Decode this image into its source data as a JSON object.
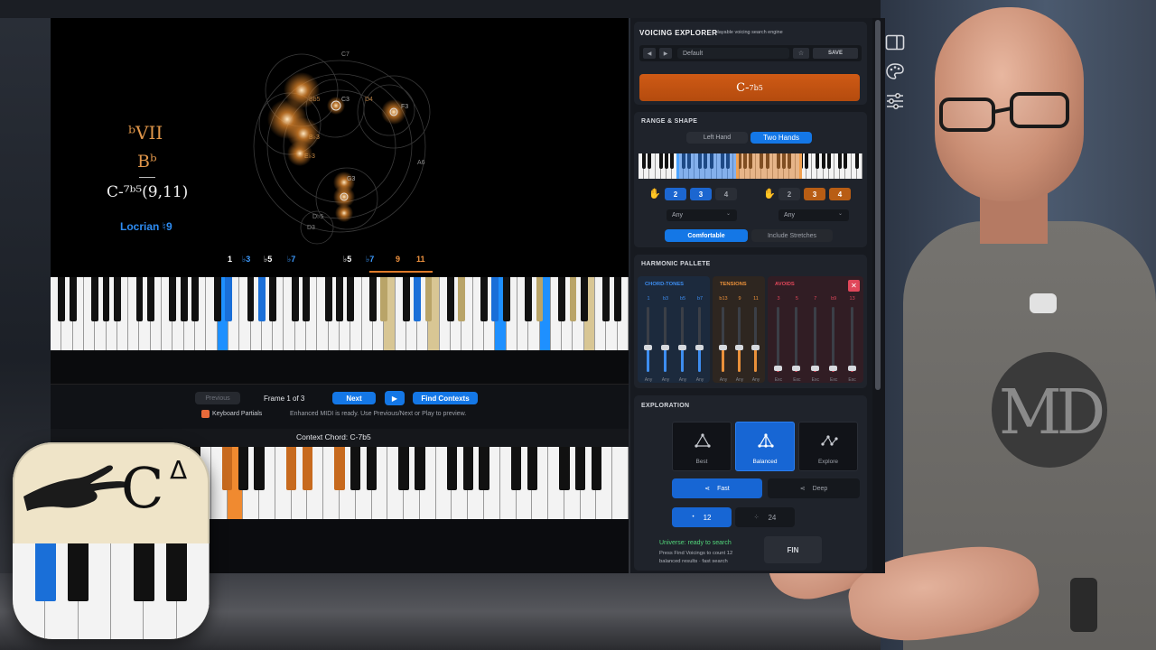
{
  "analysis": {
    "roman_numeral": "ᵇVII",
    "root_chord": "Bᵇ",
    "slash_chord": "C-⁷ᵇ⁵(9,11)",
    "scale_name": "Locrian ♮9",
    "circle_labels": [
      "C7",
      "D4",
      "B♭3",
      "E♭3",
      "C3",
      "F3",
      "G3",
      "D3",
      "A6",
      "Bb5",
      "D♭5"
    ]
  },
  "keyboard": {
    "interval_labels_blue": [
      "♭3",
      "♭7",
      "♭7"
    ],
    "interval_labels_white": [
      "1",
      "♭5",
      "♭5"
    ],
    "interval_labels_orange": [
      "9",
      "11"
    ],
    "label_b3": "♭3",
    "label_b5": "♭5",
    "label_b7": "♭7",
    "label_1": "1",
    "label_9": "9",
    "label_11": "11"
  },
  "transport": {
    "previous_label": "Previous",
    "frame_text": "Frame 1 of 3",
    "next_label": "Next",
    "play_symbol": "▶",
    "find_contexts_label": "Find Contexts",
    "keyboard_partials_label": "Keyboard Partials",
    "midi_status": "Enhanced MIDI is ready. Use Previous/Next or Play to preview."
  },
  "context": {
    "title": "Context Chord: C-7b5"
  },
  "panel": {
    "header": {
      "title": "VOICING EXPLORER",
      "subtitle": "• playable voicing search engine",
      "preset": "Default",
      "save_label": "SAVE",
      "chord_main": "C-",
      "chord_sup": "7b5"
    },
    "range_shape": {
      "title": "RANGE & SHAPE",
      "left_hand_label": "Left Hand",
      "two_hands_label": "Two Hands",
      "left_counts": [
        "2",
        "3",
        "4"
      ],
      "right_counts": [
        "2",
        "3",
        "4"
      ],
      "left_select": "Any",
      "right_select": "Any",
      "comfortable_label": "Comfortable",
      "stretches_label": "Include Stretches"
    },
    "palette": {
      "title": "HARMONIC PALLETE",
      "groups": [
        {
          "name": "CHORD-TONES",
          "color": "#3d8df0",
          "cols": [
            "1",
            "b3",
            "b5",
            "b7"
          ],
          "foot": [
            "Any",
            "Any",
            "Any",
            "Any"
          ],
          "level": 0.38
        },
        {
          "name": "TENSIONS",
          "color": "#e9903a",
          "cols": [
            "b13",
            "9",
            "11"
          ],
          "foot": [
            "Any",
            "Any",
            "Any"
          ],
          "level": 0.38
        },
        {
          "name": "AVOIDS",
          "color": "#e0475a",
          "cols": [
            "3",
            "5",
            "7",
            "b9",
            "13"
          ],
          "foot": [
            "Exc",
            "Exc",
            "Exc",
            "Exc",
            "Exc"
          ],
          "level": 0.05
        }
      ],
      "close_symbol": "✕"
    },
    "exploration": {
      "title": "EXPLORATION",
      "modes": [
        "Best",
        "Balanced",
        "Explore"
      ],
      "speed": [
        "Fast",
        "Deep"
      ],
      "count_a": "12",
      "count_b": "24",
      "status_line": "Universe: ready to search",
      "hint_line_1": "Press Find Voicings to count 12",
      "hint_line_2": "balanced results · fast search",
      "find_label": "FIN"
    }
  },
  "overlay": {
    "app_icon_text": "C",
    "app_icon_sup": "Δ",
    "shirt_logo": "MD"
  },
  "colors": {
    "accent_blue": "#1477e6",
    "chord_orange": "#c4520f",
    "tension_orange": "#e9903a",
    "avoid_red": "#e0475a",
    "roman_gold": "#e0964a"
  }
}
